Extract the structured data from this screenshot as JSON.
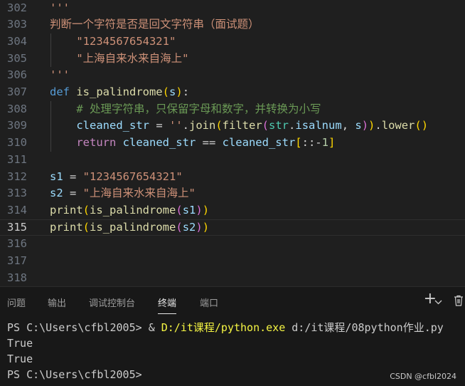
{
  "editor": {
    "lines": [
      {
        "n": "302",
        "t": [
          {
            "c": "string",
            "s": "'''"
          }
        ]
      },
      {
        "n": "303",
        "t": [
          {
            "c": "string",
            "s": "判断一个字符是否是回文字符串（面试题）"
          }
        ]
      },
      {
        "n": "304",
        "t": [
          {
            "c": "string",
            "s": "    \"1234567654321\""
          }
        ]
      },
      {
        "n": "305",
        "t": [
          {
            "c": "string",
            "s": "    \"上海自来水来自海上\""
          }
        ]
      },
      {
        "n": "306",
        "t": [
          {
            "c": "string",
            "s": "'''"
          }
        ]
      },
      {
        "n": "307",
        "t": [
          {
            "c": "keyword",
            "s": "def "
          },
          {
            "c": "func",
            "s": "is_palindrome"
          },
          {
            "c": "p1",
            "s": "("
          },
          {
            "c": "var",
            "s": "s"
          },
          {
            "c": "p1",
            "s": ")"
          },
          {
            "c": "op",
            "s": ":"
          }
        ]
      },
      {
        "n": "308",
        "t": [
          {
            "c": "comment",
            "s": "    # 处理字符串，只保留字母和数字，并转换为小写"
          }
        ]
      },
      {
        "n": "309",
        "t": [
          {
            "c": "var",
            "s": "    cleaned_str"
          },
          {
            "c": "op",
            "s": " = "
          },
          {
            "c": "string",
            "s": "''"
          },
          {
            "c": "op",
            "s": "."
          },
          {
            "c": "func",
            "s": "join"
          },
          {
            "c": "p1",
            "s": "("
          },
          {
            "c": "func",
            "s": "filter"
          },
          {
            "c": "p2",
            "s": "("
          },
          {
            "c": "class",
            "s": "str"
          },
          {
            "c": "op",
            "s": "."
          },
          {
            "c": "var",
            "s": "isalnum"
          },
          {
            "c": "op",
            "s": ", "
          },
          {
            "c": "var",
            "s": "s"
          },
          {
            "c": "p2",
            "s": ")"
          },
          {
            "c": "p1",
            "s": ")"
          },
          {
            "c": "op",
            "s": "."
          },
          {
            "c": "func",
            "s": "lower"
          },
          {
            "c": "p1",
            "s": "()"
          }
        ]
      },
      {
        "n": "310",
        "t": [
          {
            "c": "flow",
            "s": "    return "
          },
          {
            "c": "var",
            "s": "cleaned_str"
          },
          {
            "c": "op",
            "s": " == "
          },
          {
            "c": "var",
            "s": "cleaned_str"
          },
          {
            "c": "p1",
            "s": "["
          },
          {
            "c": "op",
            "s": "::-"
          },
          {
            "c": "num",
            "s": "1"
          },
          {
            "c": "p1",
            "s": "]"
          }
        ]
      },
      {
        "n": "311",
        "t": []
      },
      {
        "n": "312",
        "t": [
          {
            "c": "var",
            "s": "s1"
          },
          {
            "c": "op",
            "s": " = "
          },
          {
            "c": "string",
            "s": "\"1234567654321\""
          }
        ]
      },
      {
        "n": "313",
        "t": [
          {
            "c": "var",
            "s": "s2"
          },
          {
            "c": "op",
            "s": " = "
          },
          {
            "c": "string",
            "s": "\"上海自来水来自海上\""
          }
        ]
      },
      {
        "n": "314",
        "t": [
          {
            "c": "func",
            "s": "print"
          },
          {
            "c": "p1",
            "s": "("
          },
          {
            "c": "func",
            "s": "is_palindrome"
          },
          {
            "c": "p2",
            "s": "("
          },
          {
            "c": "var",
            "s": "s1"
          },
          {
            "c": "p2",
            "s": ")"
          },
          {
            "c": "p1",
            "s": ")"
          }
        ]
      },
      {
        "n": "315",
        "t": [
          {
            "c": "func",
            "s": "print"
          },
          {
            "c": "p1",
            "s": "("
          },
          {
            "c": "func",
            "s": "is_palindrome"
          },
          {
            "c": "p2",
            "s": "("
          },
          {
            "c": "var",
            "s": "s2"
          },
          {
            "c": "p2",
            "s": ")"
          },
          {
            "c": "p1",
            "s": ")"
          }
        ],
        "current": true
      },
      {
        "n": "316",
        "t": []
      },
      {
        "n": "317",
        "t": []
      },
      {
        "n": "318",
        "t": []
      }
    ]
  },
  "panel": {
    "tabs": [
      "问题",
      "输出",
      "调试控制台",
      "终端",
      "端口"
    ],
    "active_tab": "终端",
    "icons": [
      "plus-icon",
      "chevron-down-icon",
      "trash-icon"
    ]
  },
  "terminal": {
    "lines": [
      {
        "prompt": "PS C:\\Users\\cfbl2005> ",
        "amp": "& ",
        "exe": "D:/it课程/python.exe",
        "arg": " d:/it课程/08python作业.py"
      },
      {
        "text": "True"
      },
      {
        "text": "True"
      },
      {
        "text": "PS C:\\Users\\cfbl2005>"
      }
    ]
  },
  "watermark": "CSDN @cfbl2024",
  "colors": {
    "background": "#1f1f1f",
    "string": "#ce9178",
    "keyword": "#569cd6",
    "function": "#dcdcaa",
    "variable": "#9cdcfe",
    "comment": "#6a9955",
    "path": "#f5f543"
  }
}
